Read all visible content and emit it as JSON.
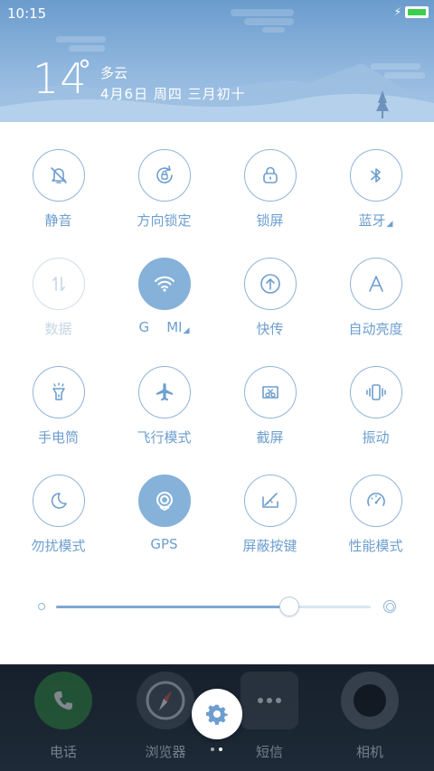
{
  "status": {
    "time": "10:15",
    "battery_color": "#3ccf4e"
  },
  "weather": {
    "temperature": "14",
    "degree": "°",
    "condition": "多云",
    "date": "4月6日 周四 三月初十"
  },
  "tiles": [
    {
      "label": "静音",
      "icon": "silent-bell-icon",
      "state": "off"
    },
    {
      "label": "方向锁定",
      "icon": "rotation-lock-icon",
      "state": "off"
    },
    {
      "label": "锁屏",
      "icon": "lock-icon",
      "state": "off"
    },
    {
      "label": "蓝牙",
      "icon": "bluetooth-icon",
      "state": "off",
      "has_more": true
    },
    {
      "label": "数据",
      "icon": "mobile-data-icon",
      "state": "disabled"
    },
    {
      "label": "G    MI",
      "icon": "wifi-icon",
      "state": "on",
      "has_more": true
    },
    {
      "label": "快传",
      "icon": "quick-share-icon",
      "state": "off"
    },
    {
      "label": "自动亮度",
      "icon": "auto-brightness-icon",
      "state": "off"
    },
    {
      "label": "手电筒",
      "icon": "flashlight-icon",
      "state": "off"
    },
    {
      "label": "飞行模式",
      "icon": "airplane-icon",
      "state": "off"
    },
    {
      "label": "截屏",
      "icon": "screenshot-icon",
      "state": "off"
    },
    {
      "label": "振动",
      "icon": "vibrate-icon",
      "state": "off"
    },
    {
      "label": "勿扰模式",
      "icon": "moon-icon",
      "state": "off"
    },
    {
      "label": "GPS",
      "icon": "gps-icon",
      "state": "on"
    },
    {
      "label": "屏蔽按键",
      "icon": "block-keys-icon",
      "state": "off"
    },
    {
      "label": "性能模式",
      "icon": "speedometer-icon",
      "state": "off"
    }
  ],
  "brightness": {
    "level": 0.74
  },
  "dock": {
    "apps": [
      {
        "label": "电话",
        "icon": "phone-icon"
      },
      {
        "label": "浏览器",
        "icon": "compass-icon"
      },
      {
        "label": "短信",
        "icon": "message-icon"
      },
      {
        "label": "相机",
        "icon": "camera-icon"
      }
    ],
    "pager": {
      "pages": 2,
      "current": 2
    }
  },
  "colors": {
    "accent": "#6d9ecf",
    "active_fill": "#86b1d9",
    "outline": "#8fb4d8"
  }
}
